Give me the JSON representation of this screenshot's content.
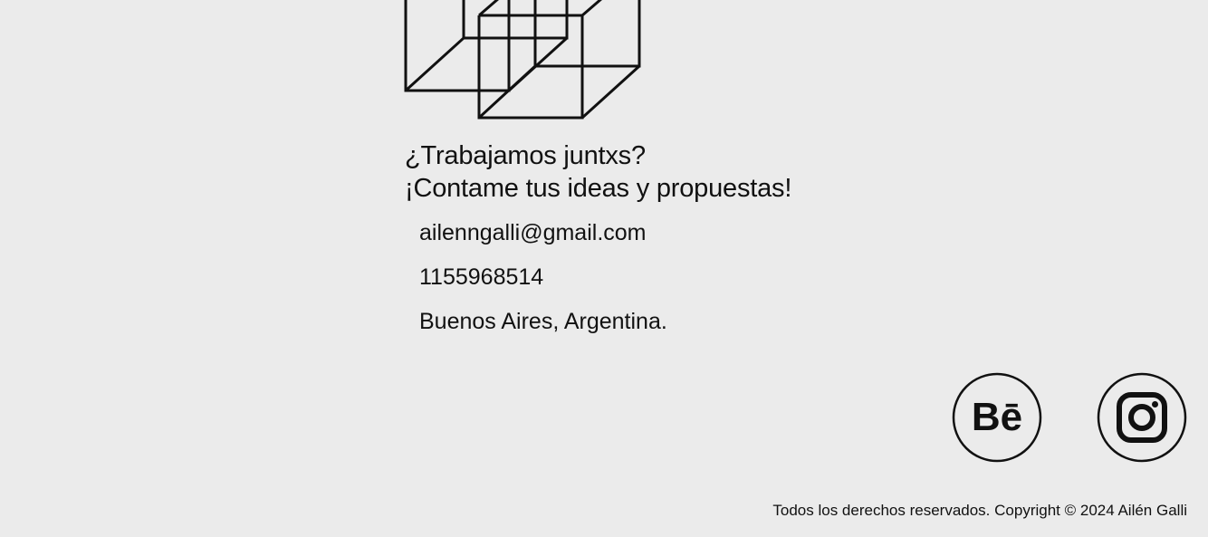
{
  "hero": {
    "illustration_icon": "wireframe-cubes-icon"
  },
  "headline": {
    "line1": "¿Trabajamos juntxs?",
    "line2": "¡Contame tus ideas y propuestas!"
  },
  "contact": {
    "email": "ailenngalli@gmail.com",
    "phone": "1155968514",
    "location": "Buenos Aires, Argentina."
  },
  "social": {
    "behance": {
      "label": "Bē",
      "icon": "behance-icon"
    },
    "instagram": {
      "icon": "instagram-icon"
    }
  },
  "footer": {
    "copyright": "Todos los derechos reservados. Copyright © 2024 Ailén Galli"
  },
  "colors": {
    "background": "#ebebeb",
    "text": "#111111"
  }
}
